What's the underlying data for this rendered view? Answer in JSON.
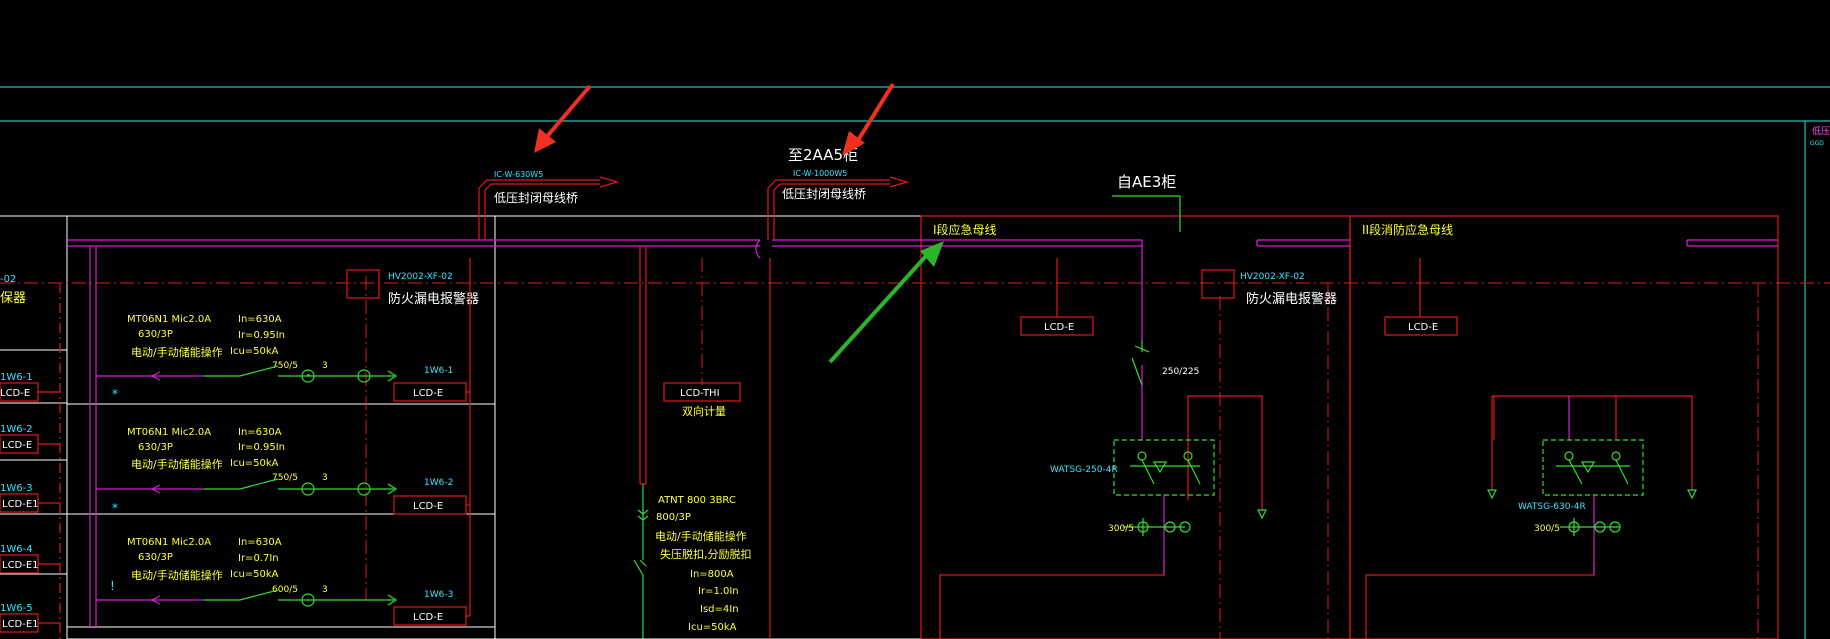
{
  "colors": {
    "background": "#000000",
    "cyan": "#1fbfbf",
    "red": "#e01818",
    "magenta": "#d21ed2",
    "green": "#33dd33",
    "yellow": "#ffff33",
    "annotation_red": "#f03020",
    "annotation_green": "#2ab52a"
  },
  "top": {
    "feed_left_tag": "IC-W-630W5",
    "feed_left": "低压封闭母线桥",
    "feed_mid_tag": "IC-W-1000W5",
    "feed_mid": "低压封闭母线桥",
    "to_2aa5": "至2AA5柜",
    "from_ae3": "自AE3柜"
  },
  "left": {
    "partial_label": "-02",
    "partial_label2": "保器",
    "rows": [
      {
        "tag": "1W6-1",
        "box": "LCD-E"
      },
      {
        "tag": "1W6-2",
        "box": "LCD-E"
      },
      {
        "tag": "1W6-3",
        "box": "LCD-E1"
      },
      {
        "tag": "1W6-4",
        "box": "LCD-E1"
      },
      {
        "tag": "1W6-5",
        "box": "LCD-E1"
      }
    ]
  },
  "panel1": {
    "monitor_model": "HV2002-XF-02",
    "monitor_name": "防火漏电报警器",
    "feeders": [
      {
        "breaker": "MT06N1  Mic2.0A",
        "poles": "630/3P",
        "op": "电动/手动储能操作",
        "in": "In=630A",
        "ir": "Ir=0.95In",
        "icu": "Icu=50kA",
        "ct": "750/5",
        "n": "3",
        "tag": "1W6-1",
        "box": "LCD-E",
        "mark": "*"
      },
      {
        "breaker": "MT06N1  Mic2.0A",
        "poles": "630/3P",
        "op": "电动/手动储能操作",
        "in": "In=630A",
        "ir": "Ir=0.95In",
        "icu": "Icu=50kA",
        "ct": "750/5",
        "n": "3",
        "tag": "1W6-2",
        "box": "LCD-E",
        "mark": "*"
      },
      {
        "breaker": "MT06N1  Mic2.0A",
        "poles": "630/3P",
        "op": "电动/手动储能操作",
        "in": "In=630A",
        "ir": "Ir=0.7In",
        "icu": "Icu=50kA",
        "ct": "600/5",
        "n": "3",
        "tag": "1W6-3",
        "box": "LCD-E",
        "mark": "!"
      }
    ]
  },
  "panel2": {
    "meter_box": "LCD-THI",
    "meter_label": "双向计量",
    "atse": "ATNT 800 3BRC",
    "atse_poles": "800/3P",
    "atse_op": "电动/手动储能操作",
    "atse_prot1": "失压脱扣,分励脱扣",
    "in": "In=800A",
    "ir": "Ir=1.0In",
    "isd": "Isd=4In",
    "icu": "Icu=50kA"
  },
  "panel3": {
    "bus_label": "I段应急母线",
    "lcd": "LCD-E",
    "monitor_model": "HV2002-XF-02",
    "monitor_name": "防火漏电报警器",
    "breaker_rating": "250/225",
    "ats": "WATSG-250-4R",
    "ct": "300/5"
  },
  "panel4": {
    "bus_label": "II段消防应急母线",
    "lcd": "LCD-E",
    "ats": "WATSG-630-4R",
    "ct": "300/5"
  },
  "far_right": {
    "label1": "低压柜",
    "label2": "GGD"
  }
}
